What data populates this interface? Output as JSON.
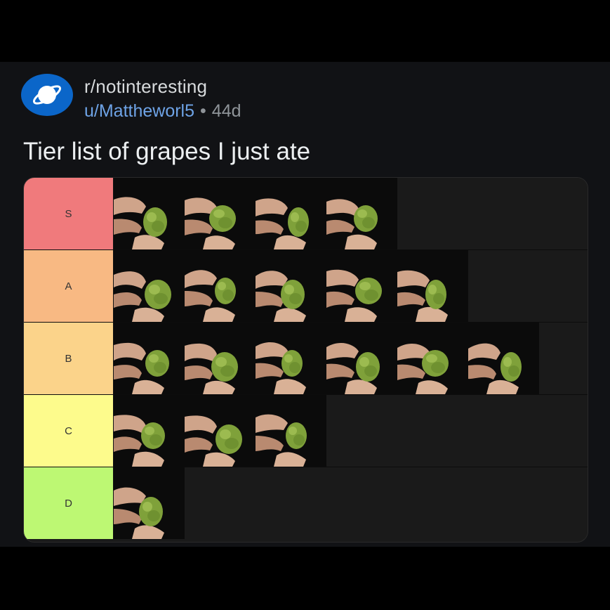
{
  "post": {
    "subreddit": "r/notinteresting",
    "user": "u/Mattheworl5",
    "separator": "•",
    "age": "44d",
    "title": "Tier list of grapes I just ate"
  },
  "tiers": [
    {
      "label": "S",
      "color": "#f07a7c",
      "count": 4
    },
    {
      "label": "A",
      "color": "#f8b983",
      "count": 5
    },
    {
      "label": "B",
      "color": "#fbd38a",
      "count": 6
    },
    {
      "label": "C",
      "color": "#fdfb8c",
      "count": 3
    },
    {
      "label": "D",
      "color": "#bdf873",
      "count": 1
    }
  ],
  "icons": {
    "avatar": "planet-icon",
    "grape": "grape-photo"
  }
}
